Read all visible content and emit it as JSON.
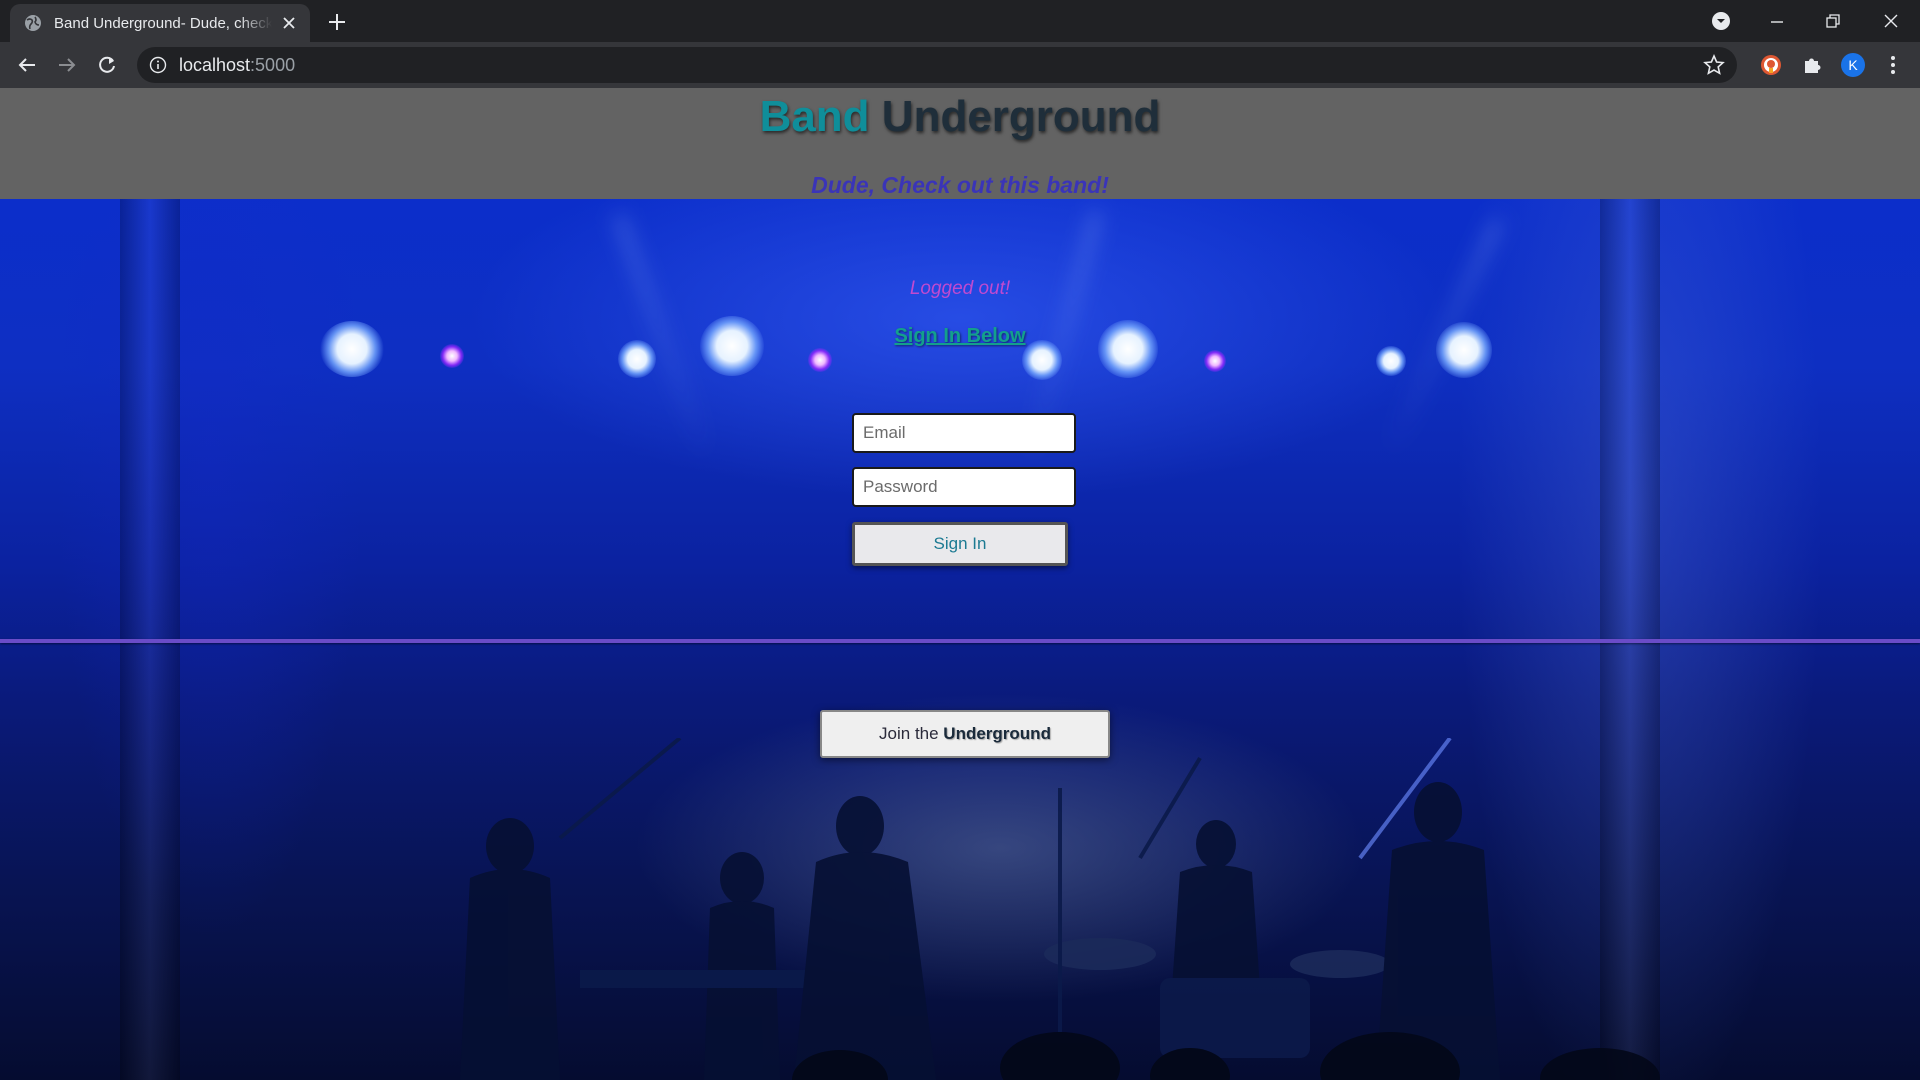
{
  "browser": {
    "tab_title": "Band Underground- Dude, check out this band!",
    "url_host": "localhost",
    "url_port": ":5000",
    "profile_initial": "K"
  },
  "header": {
    "brand_first": "Band",
    "brand_second": "Underground",
    "tagline": "Dude, Check out this band!"
  },
  "auth": {
    "status_message": "Logged out!",
    "sign_in_link": "Sign In Below",
    "email_placeholder": "Email",
    "password_placeholder": "Password",
    "sign_in_button": "Sign In"
  },
  "join": {
    "prefix": "Join the ",
    "emphasis": "Underground"
  },
  "colors": {
    "brand_accent": "#0f8e9a",
    "brand_dark": "#1f2e3a",
    "tagline": "#3a34b8",
    "status": "#c04ad0",
    "link": "#13a08c",
    "divider": "#6a4cc8"
  },
  "icons": [
    "globe-icon",
    "close-icon",
    "plus-icon",
    "profile-dropdown-icon",
    "minimize-icon",
    "restore-icon",
    "window-close-icon",
    "back-icon",
    "forward-icon",
    "reload-icon",
    "info-icon",
    "star-icon",
    "extension-icon",
    "puzzle-icon",
    "menu-icon"
  ]
}
